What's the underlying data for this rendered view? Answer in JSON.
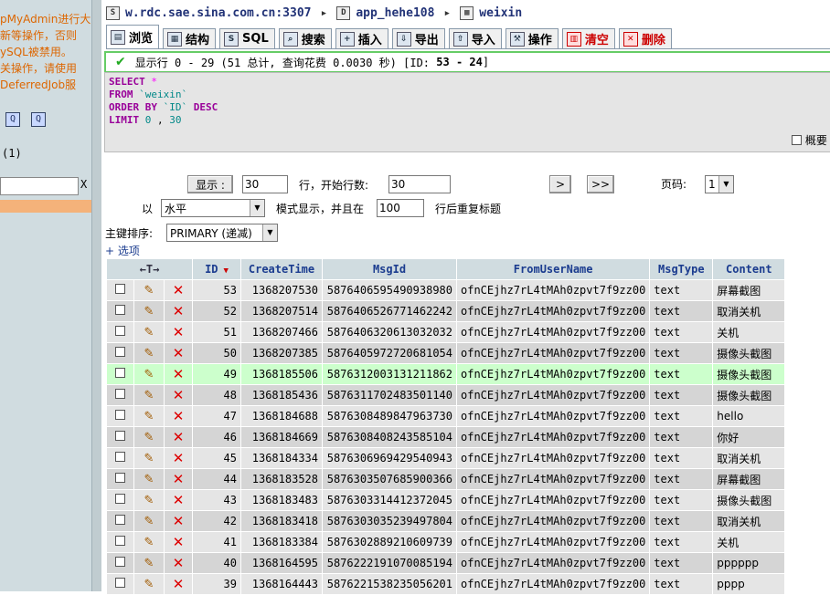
{
  "left": {
    "warning_lines": [
      "pMyAdmin进行大",
      "新等操作，否则",
      "ySQL被禁用。",
      "关操作，请使用",
      "DeferredJob服"
    ],
    "count": "(1)",
    "filter_clear": "X"
  },
  "breadcrumb": {
    "server": "w.rdc.sae.sina.com.cn:3307",
    "database": "app_hehe108",
    "table": "weixin"
  },
  "tabs": [
    {
      "label": "浏览",
      "icon": "browse-icon"
    },
    {
      "label": "结构",
      "icon": "structure-icon"
    },
    {
      "label": "SQL",
      "icon": "sql-icon"
    },
    {
      "label": "搜索",
      "icon": "search-icon"
    },
    {
      "label": "插入",
      "icon": "insert-icon"
    },
    {
      "label": "导出",
      "icon": "export-icon"
    },
    {
      "label": "导入",
      "icon": "import-icon"
    },
    {
      "label": "操作",
      "icon": "operations-icon"
    },
    {
      "label": "清空",
      "icon": "empty-icon"
    },
    {
      "label": "删除",
      "icon": "drop-icon"
    }
  ],
  "message": {
    "prefix": "显示行 0 - 29 (51 总计, 查询花费 0.0030 秒) [ID:",
    "range": "53 - 24",
    "suffix": "]"
  },
  "sql": {
    "select": "SELECT",
    "star": "*",
    "from": "FROM",
    "table": "`weixin`",
    "order_by": "ORDER BY",
    "column": "`ID`",
    "desc": "DESC",
    "limit": "LIMIT",
    "offset": "0",
    "comma": ",",
    "count": "30"
  },
  "profiling_label": "概要",
  "controls": {
    "show_button": "显示 :",
    "rows_value": "30",
    "start_label": "行，开始行数:",
    "start_value": "30",
    "next_button": ">",
    "last_button": ">>",
    "page_label": "页码:",
    "page_value": "1",
    "in_label": "以",
    "mode_value": "水平",
    "mode_label": "模式显示，并且在",
    "repeat_value": "100",
    "repeat_label": "行后重复标题",
    "sort_label": "主键排序:",
    "sort_value": "PRIMARY (递减)",
    "options_link": "+ 选项"
  },
  "table": {
    "columns": [
      "ID",
      "CreateTime",
      "MsgId",
      "FromUserName",
      "MsgType",
      "Content"
    ],
    "rows": [
      {
        "id": "53",
        "time": "1368207530",
        "msgid": "5876406595490938980",
        "from": "ofnCEjhz7rL4tMAh0zpvt7f9zz00",
        "type": "text",
        "content": "屏幕截图"
      },
      {
        "id": "52",
        "time": "1368207514",
        "msgid": "5876406526771462242",
        "from": "ofnCEjhz7rL4tMAh0zpvt7f9zz00",
        "type": "text",
        "content": "取消关机"
      },
      {
        "id": "51",
        "time": "1368207466",
        "msgid": "5876406320613032032",
        "from": "ofnCEjhz7rL4tMAh0zpvt7f9zz00",
        "type": "text",
        "content": "关机"
      },
      {
        "id": "50",
        "time": "1368207385",
        "msgid": "5876405972720681054",
        "from": "ofnCEjhz7rL4tMAh0zpvt7f9zz00",
        "type": "text",
        "content": "摄像头截图"
      },
      {
        "id": "49",
        "time": "1368185506",
        "msgid": "5876312003131211862",
        "from": "ofnCEjhz7rL4tMAh0zpvt7f9zz00",
        "type": "text",
        "content": "摄像头截图"
      },
      {
        "id": "48",
        "time": "1368185436",
        "msgid": "5876311702483501140",
        "from": "ofnCEjhz7rL4tMAh0zpvt7f9zz00",
        "type": "text",
        "content": "摄像头截图"
      },
      {
        "id": "47",
        "time": "1368184688",
        "msgid": "5876308489847963730",
        "from": "ofnCEjhz7rL4tMAh0zpvt7f9zz00",
        "type": "text",
        "content": "hello"
      },
      {
        "id": "46",
        "time": "1368184669",
        "msgid": "5876308408243585104",
        "from": "ofnCEjhz7rL4tMAh0zpvt7f9zz00",
        "type": "text",
        "content": "你好"
      },
      {
        "id": "45",
        "time": "1368184334",
        "msgid": "5876306969429540943",
        "from": "ofnCEjhz7rL4tMAh0zpvt7f9zz00",
        "type": "text",
        "content": "取消关机"
      },
      {
        "id": "44",
        "time": "1368183528",
        "msgid": "5876303507685900366",
        "from": "ofnCEjhz7rL4tMAh0zpvt7f9zz00",
        "type": "text",
        "content": "屏幕截图"
      },
      {
        "id": "43",
        "time": "1368183483",
        "msgid": "5876303314412372045",
        "from": "ofnCEjhz7rL4tMAh0zpvt7f9zz00",
        "type": "text",
        "content": "摄像头截图"
      },
      {
        "id": "42",
        "time": "1368183418",
        "msgid": "5876303035239497804",
        "from": "ofnCEjhz7rL4tMAh0zpvt7f9zz00",
        "type": "text",
        "content": "取消关机"
      },
      {
        "id": "41",
        "time": "1368183384",
        "msgid": "5876302889210609739",
        "from": "ofnCEjhz7rL4tMAh0zpvt7f9zz00",
        "type": "text",
        "content": "关机"
      },
      {
        "id": "40",
        "time": "1368164595",
        "msgid": "5876222191070085194",
        "from": "ofnCEjhz7rL4tMAh0zpvt7f9zz00",
        "type": "text",
        "content": "pppppp"
      },
      {
        "id": "39",
        "time": "1368164443",
        "msgid": "5876221538235056201",
        "from": "ofnCEjhz7rL4tMAh0zpvt7f9zz00",
        "type": "text",
        "content": "pppp"
      }
    ]
  },
  "icons": {
    "edit": "✎",
    "delete": "✕",
    "sort_desc": "▼",
    "check": "✔",
    "arrows": "←T→"
  }
}
